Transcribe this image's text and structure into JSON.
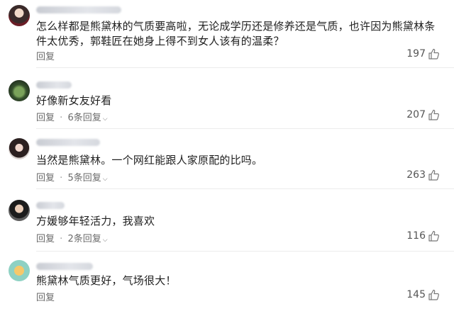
{
  "comments": [
    {
      "text": "怎么样都是熊黛林的气质要高啦，无论成学历还是修养还是气质，也许因为熊黛林条件太优秀，郭鞋匠在她身上得不到女人该有的温柔？",
      "reply_label": "回复",
      "reply_count": "",
      "likes": "197"
    },
    {
      "text": "好像新女友好看",
      "reply_label": "回复",
      "reply_count": "6条回复",
      "likes": "207"
    },
    {
      "text": "当然是熊黛林。一个网红能跟人家原配的比吗。",
      "reply_label": "回复",
      "reply_count": "5条回复",
      "likes": "263"
    },
    {
      "text": "方媛够年轻活力，我喜欢",
      "reply_label": "回复",
      "reply_count": "2条回复",
      "likes": "116"
    },
    {
      "text": "熊黛林气质更好，气场很大！",
      "reply_label": "回复",
      "reply_count": "",
      "likes": "145"
    }
  ],
  "icons": {
    "like": "thumbs-up-icon",
    "expand": "chevron-down-icon"
  },
  "colors": {
    "text": "#1f1f1f",
    "meta": "#6a6a6a"
  }
}
